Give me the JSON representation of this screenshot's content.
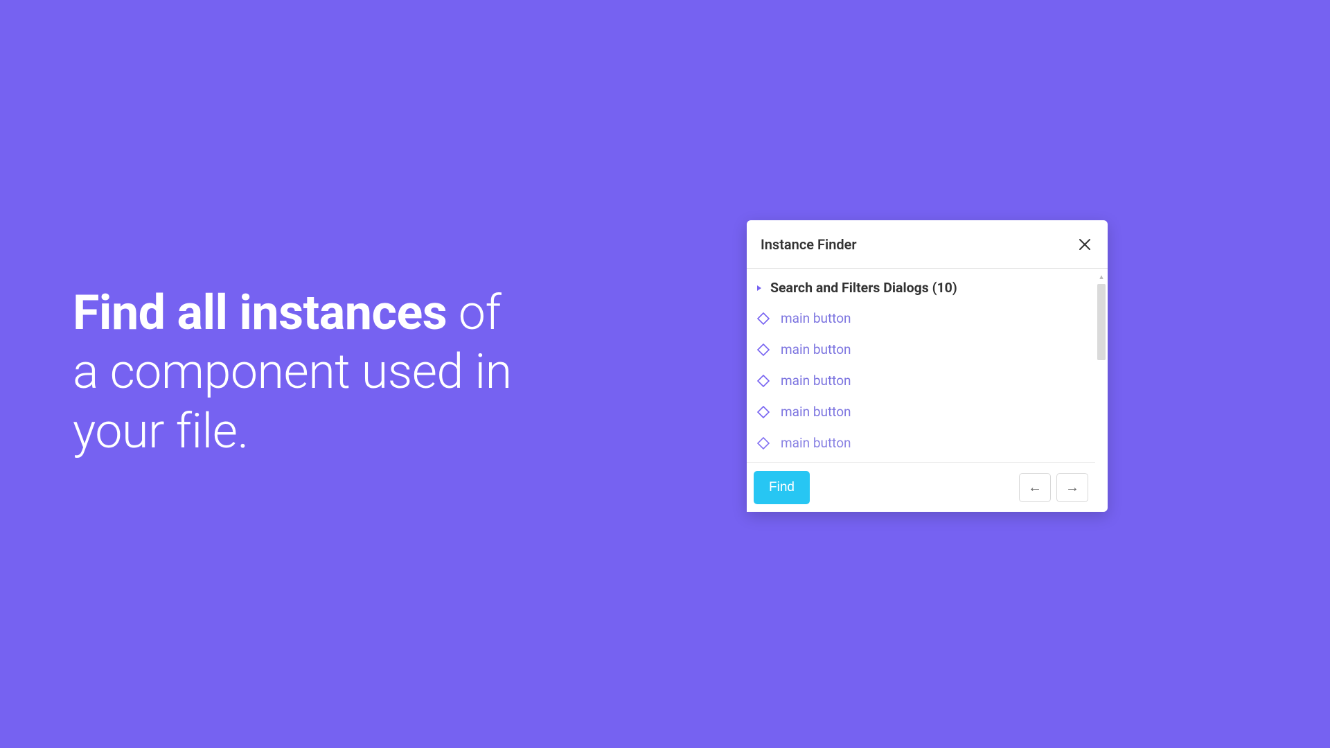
{
  "hero": {
    "bold": "Find all instances",
    "rest1": " of",
    "line2": "a component used in",
    "line3": "your file."
  },
  "panel": {
    "title": "Instance Finder",
    "group": {
      "label": "Search and Filters Dialogs (10)"
    },
    "instances": [
      {
        "label": "main button"
      },
      {
        "label": "main button"
      },
      {
        "label": "main button"
      },
      {
        "label": "main button"
      },
      {
        "label": "main button"
      }
    ],
    "footer": {
      "find_label": "Find"
    }
  },
  "icons": {
    "nav_prev": "←",
    "nav_next": "→",
    "scrollbar_up": "▴",
    "scrollbar_down": "▾"
  },
  "colors": {
    "background": "#7662F1",
    "accent_find": "#27C6F3",
    "instance_text": "#7d75e0"
  }
}
